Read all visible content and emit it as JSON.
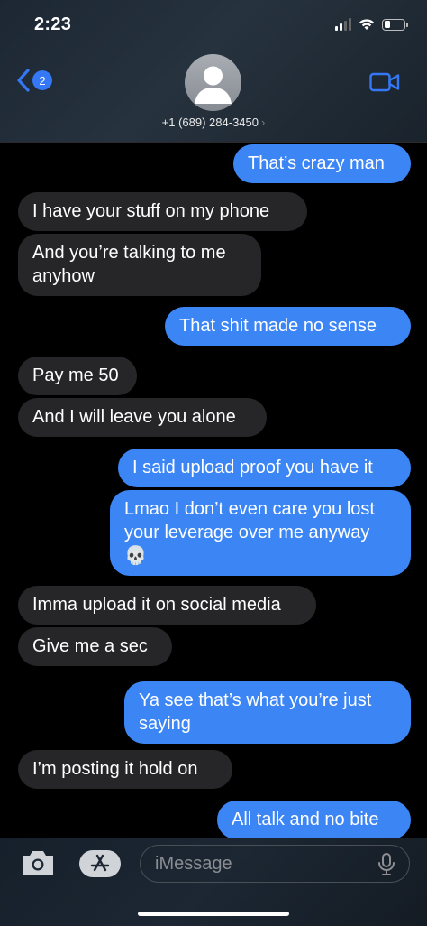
{
  "status_bar": {
    "time": "2:23",
    "battery_level": 0.3
  },
  "header": {
    "back_badge": "2",
    "contact": "+1 (689) 284-3450",
    "chevron": "›",
    "icons": {
      "back": "chevron-left-icon",
      "video": "video-camera-icon",
      "avatar": "person-silhouette-icon"
    }
  },
  "messages": [
    {
      "dir": "out",
      "text": "That’s crazy man"
    },
    {
      "dir": "in",
      "text": "I have your stuff on my phone"
    },
    {
      "dir": "in",
      "text": "And you’re talking to me anyhow"
    },
    {
      "dir": "out",
      "text": "That shit made no sense"
    },
    {
      "dir": "in",
      "text": "Pay me 50"
    },
    {
      "dir": "in",
      "text": "And I will leave you alone"
    },
    {
      "dir": "out",
      "text": "I said upload proof you have it"
    },
    {
      "dir": "out",
      "text": "Lmao I don’t even care you lost your leverage over me anyway 💀"
    },
    {
      "dir": "in",
      "text": "Imma upload it on social media"
    },
    {
      "dir": "in",
      "text": "Give me a sec"
    },
    {
      "dir": "out",
      "text": "Ya see that’s what you’re just saying"
    },
    {
      "dir": "in",
      "text": "I’m posting it hold on"
    },
    {
      "dir": "out",
      "text": "All talk and no bite"
    }
  ],
  "composer": {
    "placeholder": "iMessage",
    "icons": {
      "camera": "camera-icon",
      "apps": "app-store-icon",
      "mic": "microphone-icon"
    }
  },
  "colors": {
    "outgoing": "#3c85f5",
    "incoming": "#262628",
    "accent": "#3478f6"
  }
}
